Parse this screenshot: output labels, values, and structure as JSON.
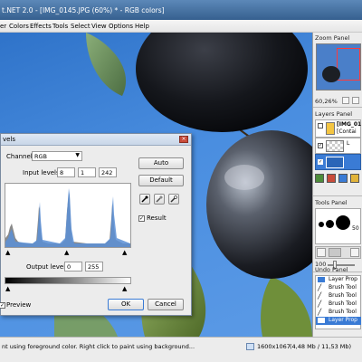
{
  "window": {
    "title": "t.NET 2.0 - [IMG_0145.JPG (60%) * - RGB colors]"
  },
  "menubar": {
    "items": [
      "er",
      "Colors",
      "Effects",
      "Tools",
      "Select",
      "View",
      "Options",
      "Help"
    ]
  },
  "zoom_panel": {
    "title": "Zoom Panel",
    "zoom_value": "60,26%"
  },
  "layers_panel": {
    "title": "Layers Panel",
    "items": [
      {
        "line1": "[IMG_01",
        "line2": "[Contai"
      },
      {
        "line1": "L",
        "line2": ""
      },
      {
        "line1": "",
        "line2": ""
      }
    ]
  },
  "tools_panel": {
    "title": "Tools Panel",
    "brush_size_label": "50",
    "slider_value": "100"
  },
  "undo_panel": {
    "title": "Undo Panel",
    "items": [
      "Layer Prop",
      "Brush Tool",
      "Brush Tool",
      "Brush Tool",
      "Brush Tool",
      "Layer Prop"
    ],
    "selected_index": 5
  },
  "status_bar": {
    "message": "nt using foreground color. Right click to paint using background...",
    "dimensions": "1600x1067",
    "memory": "(4,48 Mb / 11,53 Mb)"
  },
  "levels_dialog": {
    "title": "vels",
    "channel_label": "Channel:",
    "channel_value": "RGB",
    "input_levels_label": "Input levels:",
    "input_low": "8",
    "input_gamma": "1",
    "input_high": "242",
    "output_levels_label": "Output levels:",
    "output_low": "0",
    "output_high": "255",
    "auto_button": "Auto",
    "default_button": "Default",
    "result_label": "Result",
    "result_checked": true,
    "preview_label": "Preview",
    "preview_checked": true,
    "ok_button": "OK",
    "cancel_button": "Cancel"
  },
  "colors": {
    "accent_selection": "#3a7bd5",
    "sky_blue": "#4a8ee0",
    "histogram_blue": "#5a8fd6",
    "histogram_gray": "#8a8a8a"
  }
}
